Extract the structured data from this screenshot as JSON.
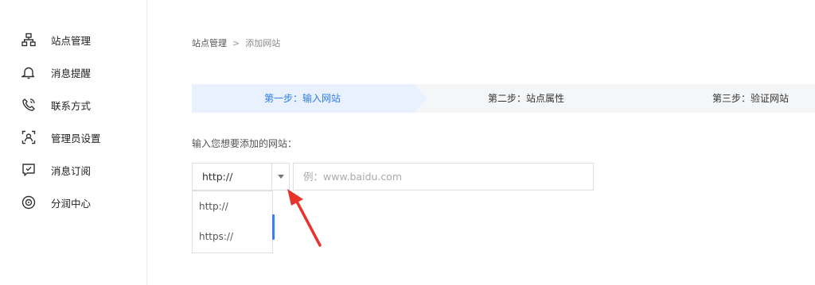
{
  "sidebar": {
    "items": [
      {
        "label": "站点管理",
        "icon": "sitemap-icon"
      },
      {
        "label": "消息提醒",
        "icon": "bell-icon"
      },
      {
        "label": "联系方式",
        "icon": "phone-icon"
      },
      {
        "label": "管理员设置",
        "icon": "admin-id-icon"
      },
      {
        "label": "消息订阅",
        "icon": "subscribe-icon"
      },
      {
        "label": "分润中心",
        "icon": "revenue-icon"
      }
    ]
  },
  "breadcrumb": {
    "parent": "站点管理",
    "separator": ">",
    "current": "添加网站"
  },
  "steps": [
    {
      "label": "第一步：输入网站",
      "active": true
    },
    {
      "label": "第二步：站点属性",
      "active": false
    },
    {
      "label": "第三步：验证网站",
      "active": false
    }
  ],
  "form": {
    "label": "输入您想要添加的网站：",
    "protocol_value": "http://",
    "url_placeholder": "例：www.baidu.com",
    "url_value": ""
  },
  "dropdown": {
    "options": [
      "http://",
      "https://"
    ]
  },
  "colors": {
    "accent": "#2d7cf3",
    "active_step_bg": "#e8f1fd",
    "steps_bg": "#f5f6f7",
    "annotation": "#e8332a"
  }
}
